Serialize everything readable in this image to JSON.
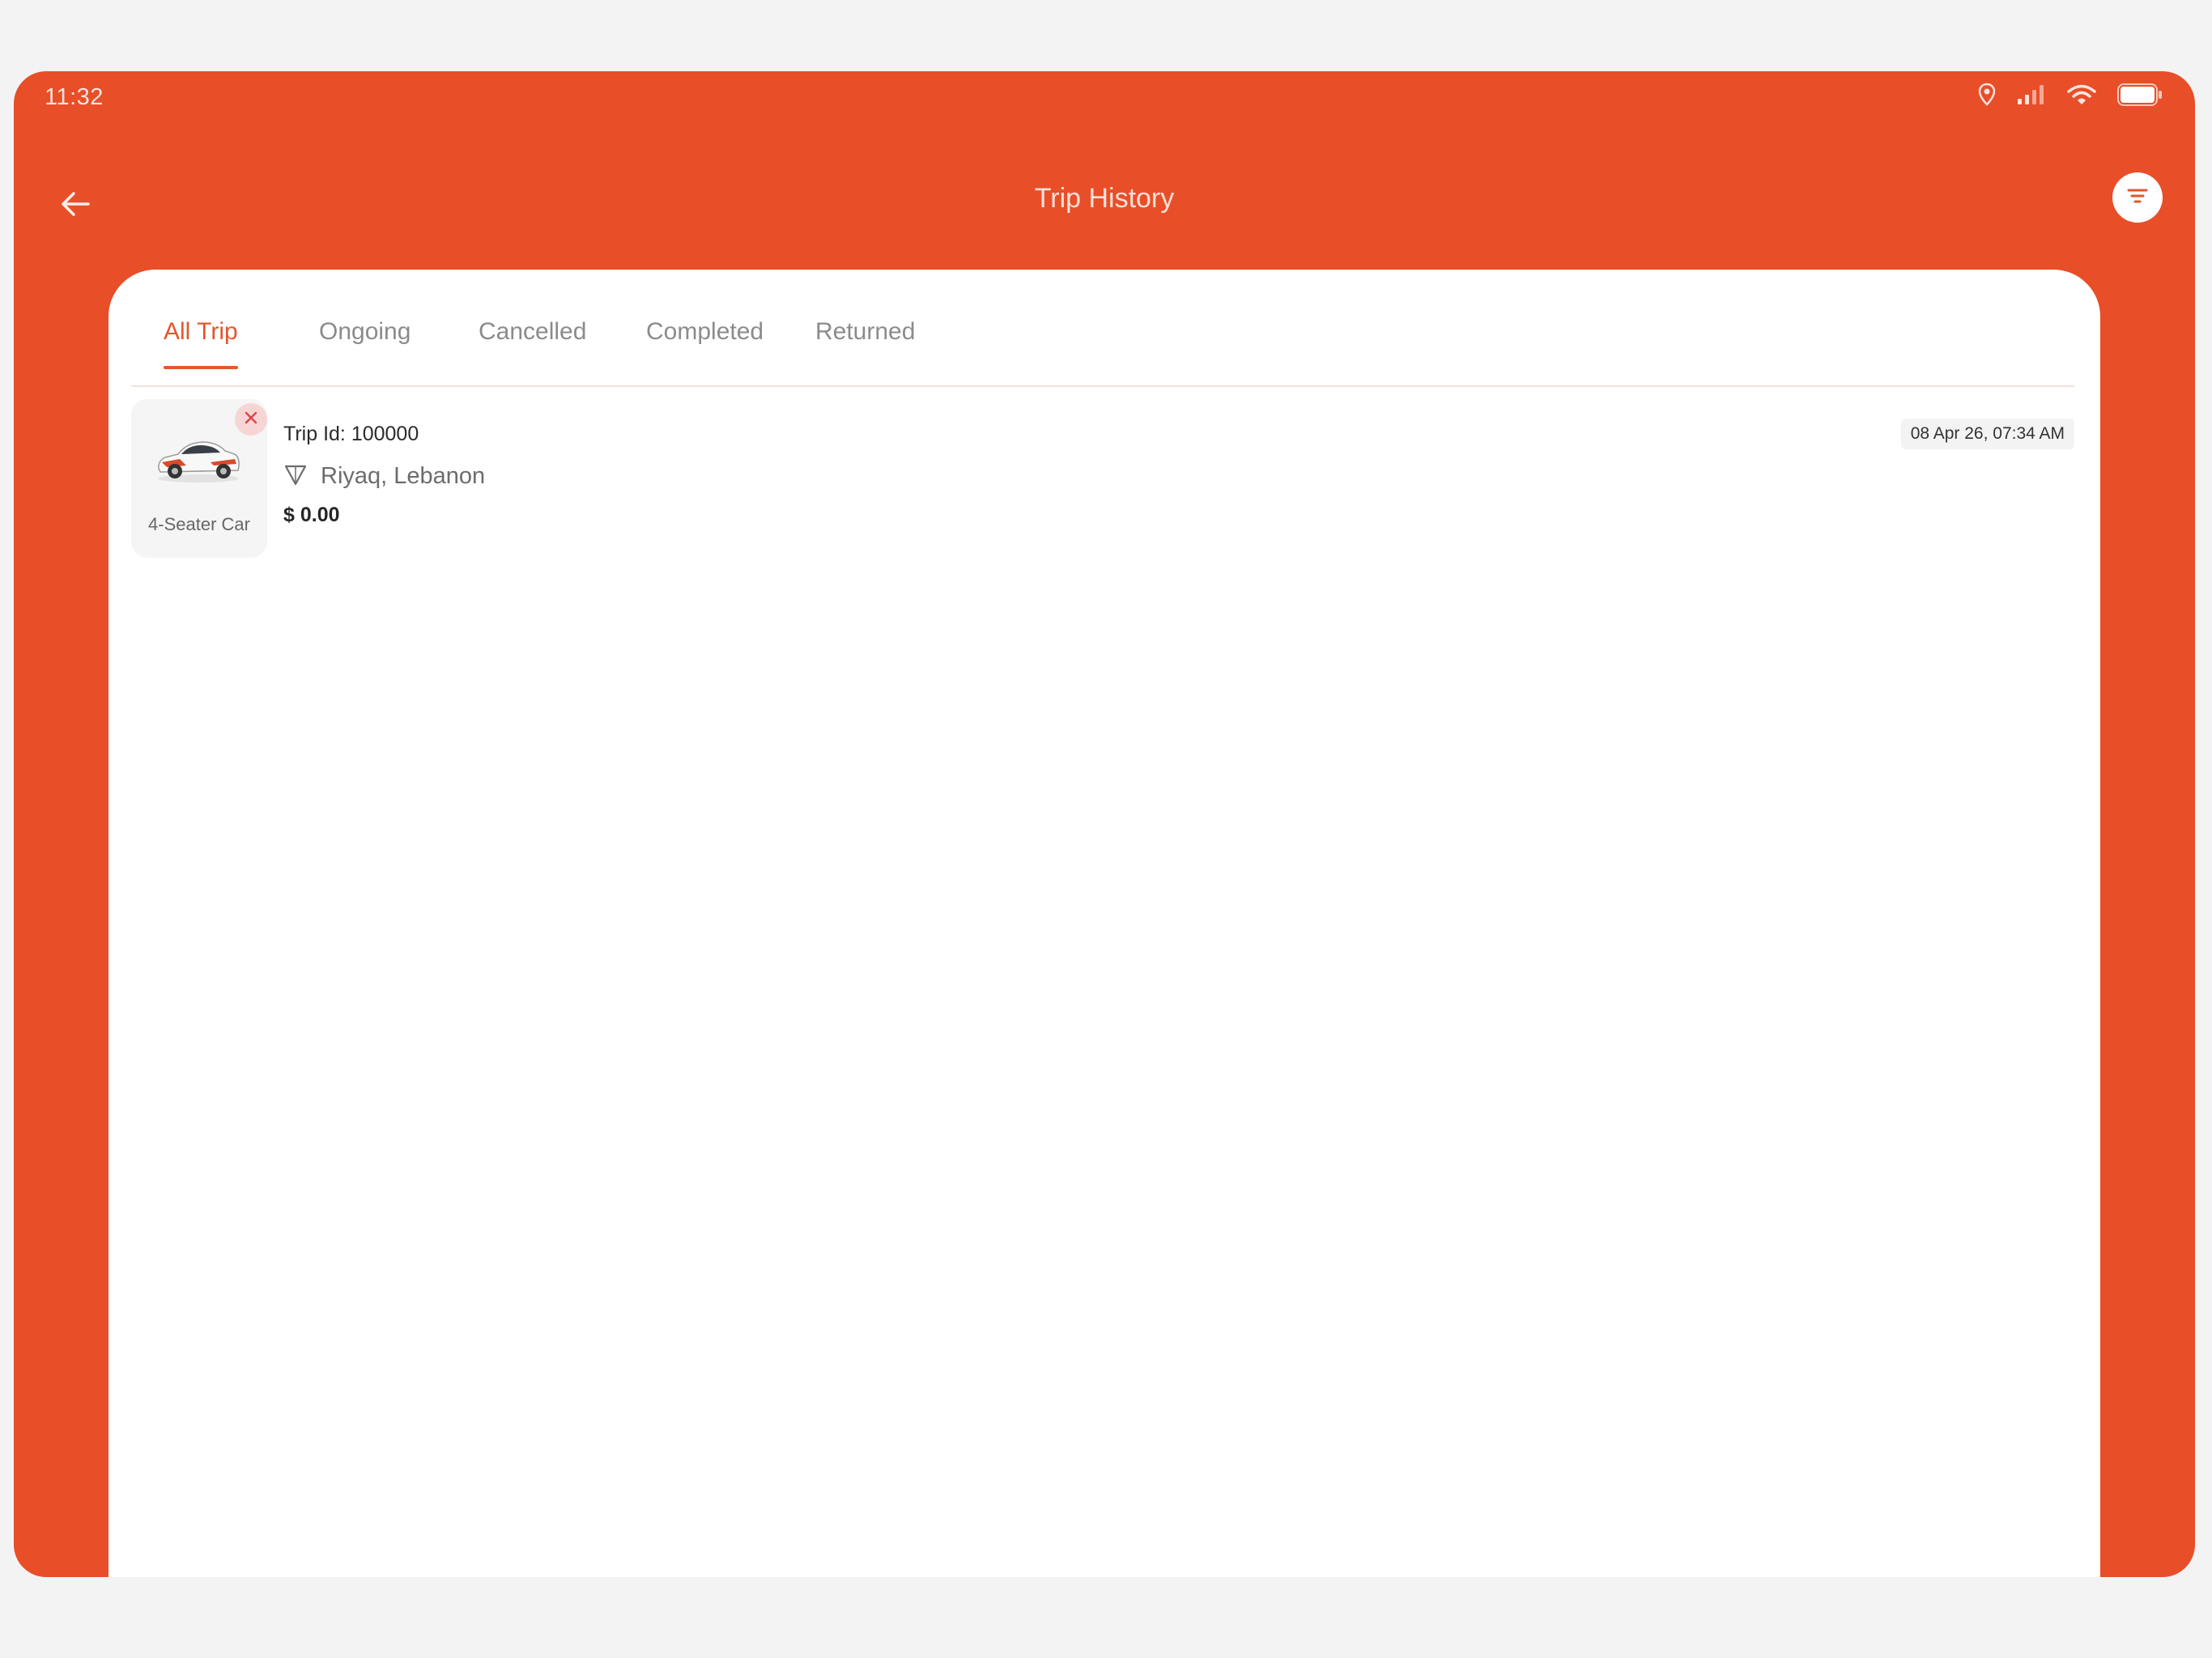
{
  "status_bar": {
    "time": "11:32",
    "icons": [
      "location-icon",
      "cellular-signal-icon",
      "wifi-icon",
      "battery-icon"
    ]
  },
  "header": {
    "title": "Trip History",
    "back_icon": "arrow-left-icon",
    "filter_icon": "filter-icon"
  },
  "tabs": [
    {
      "label": "All Trip",
      "active": true
    },
    {
      "label": "Ongoing",
      "active": false
    },
    {
      "label": "Cancelled",
      "active": false
    },
    {
      "label": "Completed",
      "active": false
    },
    {
      "label": "Returned",
      "active": false
    }
  ],
  "trips": [
    {
      "vehicle_type": "4-Seater Car",
      "status_icon": "close-icon",
      "trip_id": "Trip Id: 100000",
      "location": "Riyaq, Lebanon",
      "fare": "$ 0.00",
      "datetime": "08 Apr 26, 07:34 AM"
    }
  ],
  "colors": {
    "brand": "#e84e28",
    "active_tab": "#e2572d",
    "cancel_badge_bg": "#f7d5d5",
    "cancel_badge_icon": "#e0454a",
    "card_bg": "#ffffff"
  }
}
